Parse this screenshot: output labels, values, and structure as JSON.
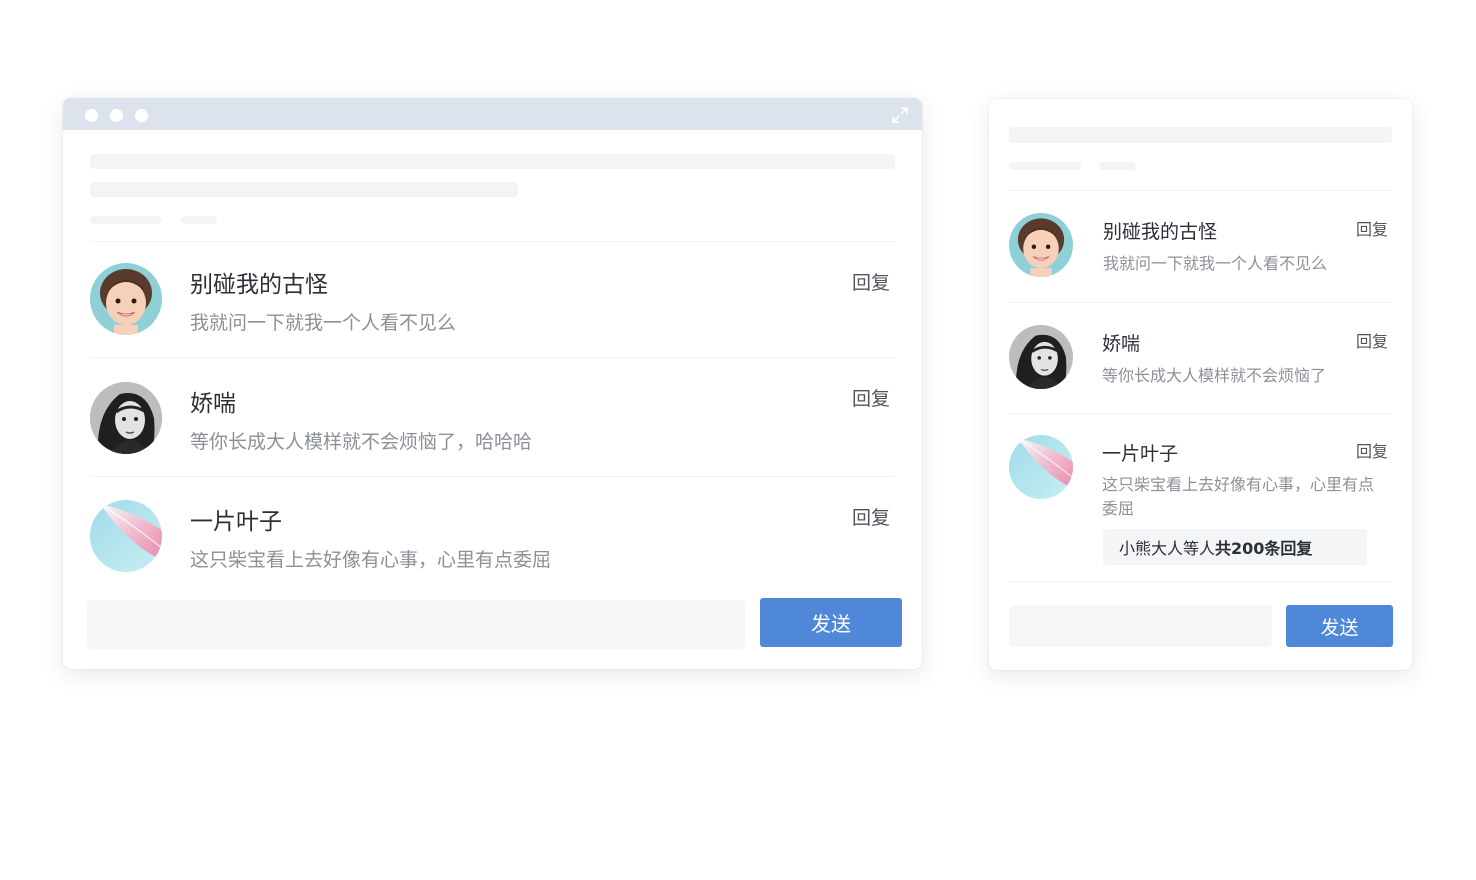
{
  "desktop": {
    "comments": [
      {
        "name": "别碰我的古怪",
        "message": "我就问一下就我一个人看不见么",
        "reply_label": "回复",
        "avatar": "girl-portrait"
      },
      {
        "name": "娇喘",
        "message": "等你长成大人模样就不会烦恼了，哈哈哈",
        "reply_label": "回复",
        "avatar": "bw-woman-portrait"
      },
      {
        "name": "一片叶子",
        "message": "这只柴宝看上去好像有心事，心里有点委屈",
        "reply_label": "回复",
        "avatar": "pink-feather"
      }
    ],
    "send_label": "发送"
  },
  "mobile": {
    "comments": [
      {
        "name": "别碰我的古怪",
        "message": "我就问一下就我一个人看不见么",
        "reply_label": "回复",
        "avatar": "girl-portrait"
      },
      {
        "name": "娇喘",
        "message": "等你长成大人模样就不会烦恼了",
        "reply_label": "回复",
        "avatar": "bw-woman-portrait"
      },
      {
        "name": "一片叶子",
        "message": "这只柴宝看上去好像有心事，心里有点委屈",
        "reply_label": "回复",
        "avatar": "pink-feather"
      }
    ],
    "sub_replies": {
      "who": "小熊大人等人",
      "count_text": "共200条回复"
    },
    "send_label": "发送"
  },
  "colors": {
    "accent": "#4f87d9",
    "title_bar": "#dde3ec"
  }
}
